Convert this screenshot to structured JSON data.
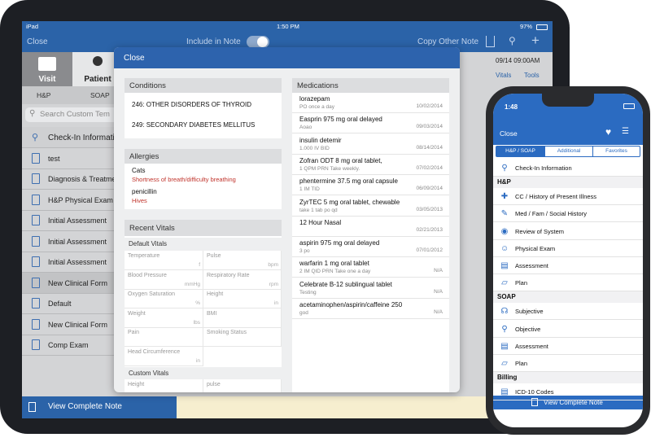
{
  "ipad": {
    "status_bar": {
      "left": "iPad",
      "time": "1:50 PM",
      "battery": "97%"
    },
    "nav": {
      "close": "Close",
      "include_in_note": "Include in Note",
      "copy_other_note": "Copy Other Note"
    },
    "tabs": {
      "visit": "Visit",
      "patient": "Patient"
    },
    "subtabs": {
      "hp": "H&P",
      "soap": "SOAP"
    },
    "search_placeholder": "Search Custom Tem",
    "right_header": {
      "date": "09/14 09:00AM",
      "vitals": "Vitals",
      "tools": "Tools"
    },
    "list_items": [
      "Check-In Informatio",
      "test",
      "Diagnosis & Treatme",
      "H&P Physical Exam",
      "Initial Assessment",
      "Initial Assessment",
      "Initial Assessment",
      "New Clinical Form",
      "Default",
      "New Clinical Form",
      "Comp Exam"
    ],
    "bottom_bar": "View Complete Note",
    "pulse_row": {
      "name": "Pulse",
      "unit": "bpm"
    }
  },
  "modal": {
    "close": "Close",
    "conditions": {
      "title": "Conditions",
      "items": [
        "246: OTHER DISORDERS OF THYROID",
        "249: SECONDARY DIABETES MELLITUS"
      ]
    },
    "allergies": {
      "title": "Allergies",
      "items": [
        {
          "name": "Cats",
          "reaction": "Shortness of breath/difficulty breathing"
        },
        {
          "name": "penicillin",
          "reaction": "Hives"
        }
      ]
    },
    "vitals": {
      "title": "Recent Vitals",
      "default_label": "Default Vitals",
      "cells": [
        {
          "label": "Temperature",
          "unit": "f"
        },
        {
          "label": "Pulse",
          "unit": "bpm"
        },
        {
          "label": "Blood Pressure",
          "unit": "mmHg"
        },
        {
          "label": "Respiratory Rate",
          "unit": "rpm"
        },
        {
          "label": "Oxygen Saturation",
          "unit": "%"
        },
        {
          "label": "Height",
          "unit": "in"
        },
        {
          "label": "Weight",
          "unit": "lbs"
        },
        {
          "label": "BMI",
          "unit": ""
        },
        {
          "label": "Pain",
          "unit": ""
        },
        {
          "label": "Smoking Status",
          "unit": ""
        },
        {
          "label": "Head Circumference",
          "unit": "in"
        }
      ],
      "custom_label": "Custom Vitals",
      "custom_cells": [
        {
          "label": "Height"
        },
        {
          "label": "pulse"
        }
      ]
    },
    "medications": {
      "title": "Medications",
      "items": [
        {
          "name": "lorazepam",
          "sig": "PO once a day",
          "date": "10/02/2014"
        },
        {
          "name": "Easprin 975 mg oral delayed",
          "sig": "Aoao",
          "date": "09/03/2014"
        },
        {
          "name": "insulin detemir",
          "sig": "1.000  IV BID",
          "date": "08/14/2014"
        },
        {
          "name": "Zofran ODT 8 mg oral tablet,",
          "sig": "1  QPM PRN Take weekly.",
          "date": "07/02/2014"
        },
        {
          "name": "phentermine 37.5 mg oral capsule",
          "sig": "1  IM TID",
          "date": "06/09/2014"
        },
        {
          "name": "ZyrTEC 5 mg oral tablet, chewable",
          "sig": "take 1 tab po qd",
          "date": "03/05/2013"
        },
        {
          "name": "12 Hour Nasal",
          "sig": "",
          "date": "02/21/2013"
        },
        {
          "name": "aspirin 975 mg oral delayed",
          "sig": "3 po",
          "date": "07/01/2012"
        },
        {
          "name": "warfarin 1 mg oral tablet",
          "sig": "2  IM QID PRN Take one a day",
          "date": "N/A"
        },
        {
          "name": "Celebrate B-12 sublingual tablet",
          "sig": "Testing",
          "date": "N/A"
        },
        {
          "name": "acetaminophen/aspirin/caffeine 250",
          "sig": "god",
          "date": "N/A"
        }
      ]
    }
  },
  "iphone": {
    "time": "1:48",
    "close": "Close",
    "segments": [
      "H&P / SOAP",
      "Additional",
      "Favorites"
    ],
    "checkin": "Check-In Information",
    "sections": [
      {
        "title": "H&P",
        "items": [
          "CC / History of Present Illness",
          "Med / Fam / Social History",
          "Review of System",
          "Physical Exam",
          "Assessment",
          "Plan"
        ]
      },
      {
        "title": "SOAP",
        "items": [
          "Subjective",
          "Objective",
          "Assessment",
          "Plan"
        ]
      },
      {
        "title": "Billing",
        "items": [
          "ICD-10 Codes"
        ]
      }
    ],
    "bottom_button": "View Complete Note"
  },
  "colors": {
    "primary_blue": "#2b63a8",
    "iphone_blue": "#2b6bc1",
    "allergy_red": "#c0332b"
  }
}
